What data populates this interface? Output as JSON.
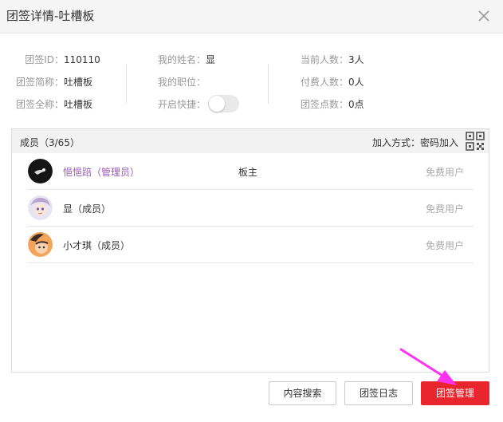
{
  "dialog": {
    "title": "团签详情-吐槽板"
  },
  "info": {
    "col1": [
      {
        "label": "团签ID：",
        "value": "110110"
      },
      {
        "label": "团签简称：",
        "value": "吐槽板"
      },
      {
        "label": "团签全称：",
        "value": "吐槽板"
      }
    ],
    "col2": [
      {
        "label": "我的姓名：",
        "value": "显"
      },
      {
        "label": "我的职位：",
        "value": ""
      },
      {
        "label": "开启快捷：",
        "value": ""
      }
    ],
    "col3": [
      {
        "label": "当前人数：",
        "value": "3人"
      },
      {
        "label": "付费人数：",
        "value": "0人"
      },
      {
        "label": "团签点数：",
        "value": "0点"
      }
    ],
    "shortcut_enabled": false
  },
  "members": {
    "count_label": "成员（3/65）",
    "join_label": "加入方式：密码加入",
    "list": [
      {
        "name": "悒悒踣（管理员）",
        "role": "板主",
        "type": "免费用户",
        "avatar": "dark-avatar"
      },
      {
        "name": "显（成员）",
        "role": "",
        "type": "免费用户",
        "avatar": "anime-avatar"
      },
      {
        "name": "小才琪（成员）",
        "role": "",
        "type": "免费用户",
        "avatar": "orange-avatar"
      }
    ]
  },
  "buttons": {
    "search": "内容搜索",
    "log": "团签日志",
    "manage": "团签管理"
  },
  "colors": {
    "accent": "#e9262d",
    "admin_name": "#9b59b6",
    "annotation_arrow": "#ff33ee"
  }
}
